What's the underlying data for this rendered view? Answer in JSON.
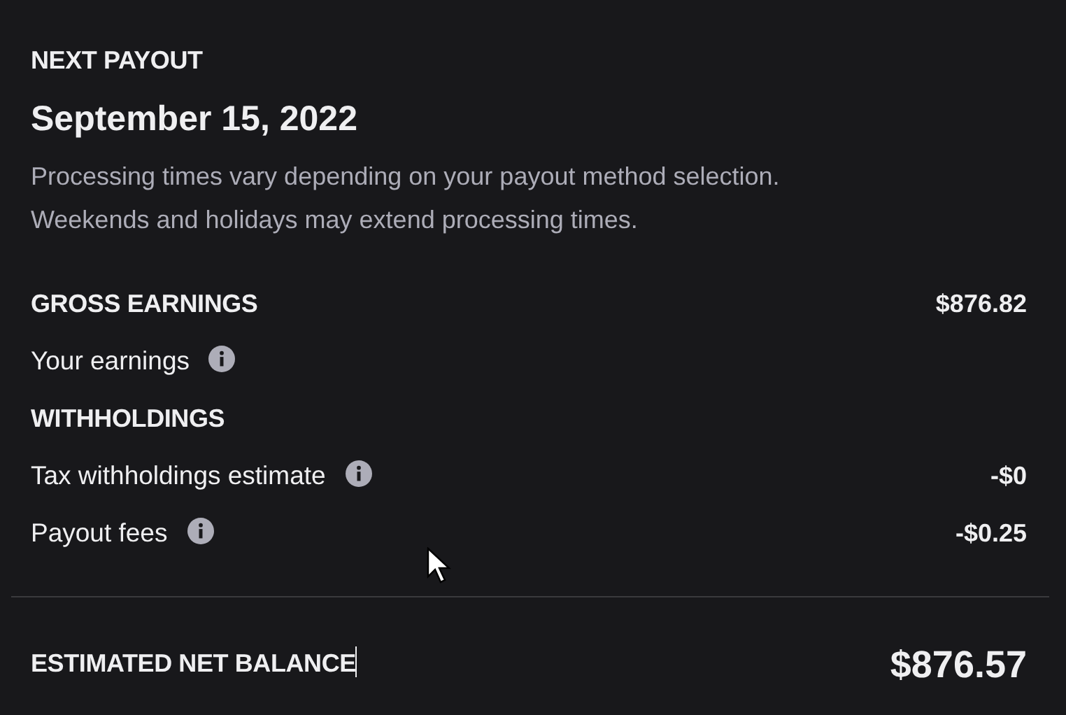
{
  "next_payout": {
    "label": "NEXT PAYOUT",
    "date": "September 15, 2022",
    "notes": [
      "Processing times vary depending on your payout method selection.",
      "Weekends and holidays may extend processing times."
    ]
  },
  "sections": [
    {
      "kind": "header",
      "label": "GROSS EARNINGS",
      "amount": "$876.82"
    },
    {
      "kind": "line",
      "label": "Your earnings",
      "info": true
    },
    {
      "kind": "header",
      "label": "WITHHOLDINGS"
    },
    {
      "kind": "line",
      "label": "Tax withholdings estimate",
      "info": true,
      "amount": "-$0"
    },
    {
      "kind": "line",
      "label": "Payout fees",
      "info": true,
      "amount": "-$0.25"
    }
  ],
  "net": {
    "label": "ESTIMATED NET BALANCE",
    "amount": "$876.57"
  }
}
